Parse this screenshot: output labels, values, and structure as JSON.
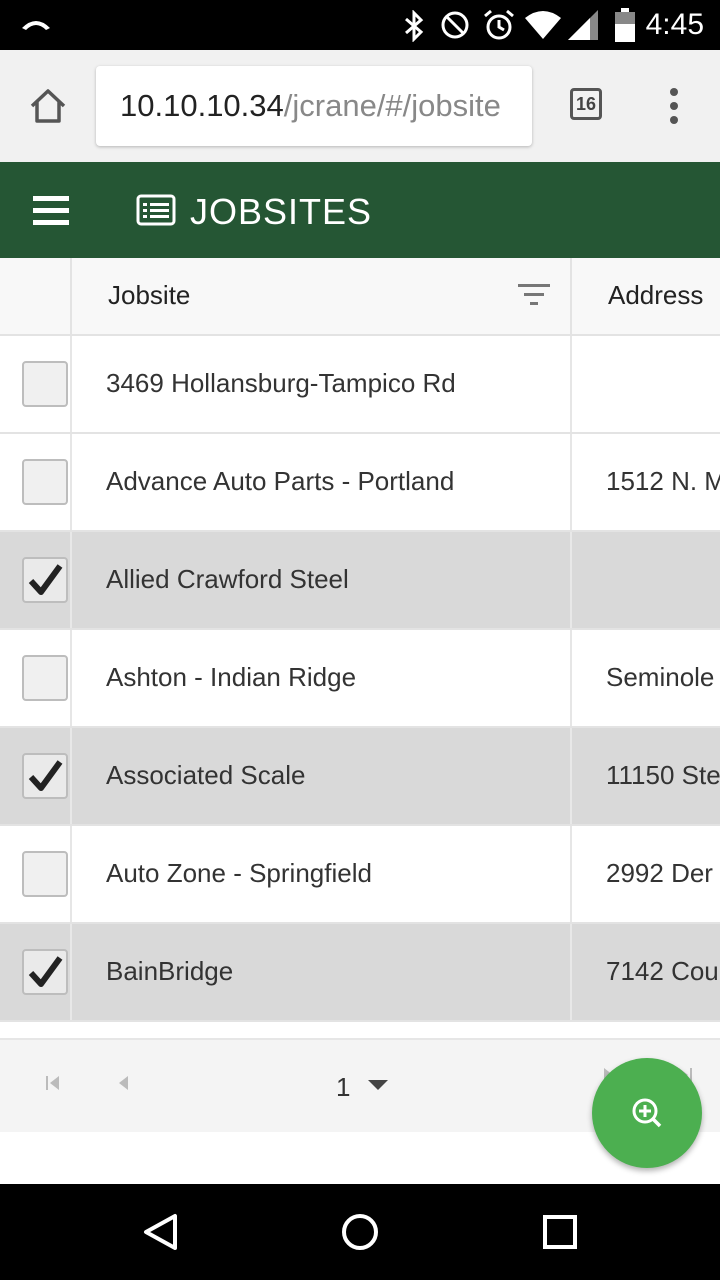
{
  "status_bar": {
    "time": "4:45",
    "icons": [
      "cast-icon",
      "bluetooth-icon",
      "do-not-disturb-icon",
      "alarm-icon",
      "wifi-icon",
      "signal-icon",
      "battery-icon"
    ]
  },
  "browser": {
    "url_host": "10.10.10.34",
    "url_path": "/jcrane/#/jobsite",
    "tab_count": "16",
    "icons": [
      "home-icon",
      "tabs-icon",
      "overflow-menu-icon"
    ]
  },
  "app_bar": {
    "title": "JOBSITES",
    "icons": [
      "menu-icon",
      "list-icon"
    ]
  },
  "grid": {
    "columns": [
      "Jobsite",
      "Address"
    ],
    "rows": [
      {
        "name": "3469 Hollansburg-Tampico Rd",
        "address": "",
        "checked": false
      },
      {
        "name": "Advance Auto Parts - Portland",
        "address": "1512 N. M",
        "checked": false
      },
      {
        "name": "Allied Crawford Steel",
        "address": "",
        "checked": true
      },
      {
        "name": "Ashton - Indian Ridge",
        "address": "Seminole",
        "checked": false
      },
      {
        "name": "Associated Scale",
        "address": "11150 Ste",
        "checked": true
      },
      {
        "name": "Auto Zone - Springfield",
        "address": "2992 Der",
        "checked": false
      },
      {
        "name": "BainBridge",
        "address": "7142 Cou",
        "checked": true
      }
    ]
  },
  "pager": {
    "page": "1"
  },
  "colors": {
    "app_bar": "#255634",
    "fab": "#4caf50",
    "selected_row": "#d9d9d9"
  }
}
